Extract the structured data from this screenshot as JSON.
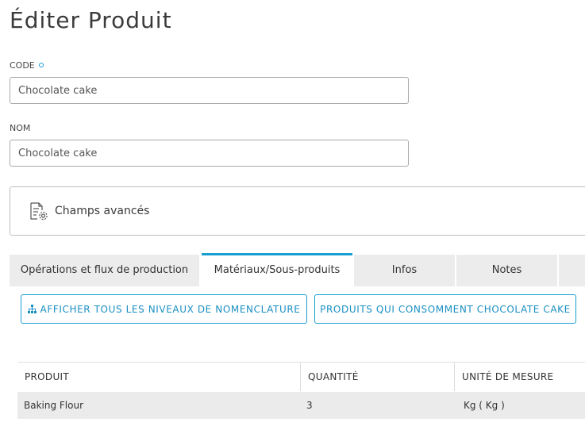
{
  "page": {
    "title": "Éditer Produit"
  },
  "form": {
    "code": {
      "label": "CODE",
      "value": "Chocolate cake"
    },
    "name": {
      "label": "NOM",
      "value": "Chocolate cake"
    }
  },
  "advanced": {
    "label": "Champs avancés",
    "icon": "document-settings-icon"
  },
  "tabs": [
    {
      "label": "Opérations et flux de production",
      "active": false
    },
    {
      "label": "Matériaux/Sous-produits",
      "active": true
    },
    {
      "label": "Infos",
      "active": false
    },
    {
      "label": "Notes",
      "active": false
    }
  ],
  "actions": {
    "show_levels": {
      "label": "AFFICHER TOUS LES NIVEAUX DE NOMENCLATURE",
      "icon": "hierarchy-icon"
    },
    "consuming_products": {
      "label": "PRODUITS QUI CONSOMMENT CHOCOLATE CAKE"
    }
  },
  "table": {
    "columns": [
      "PRODUIT",
      "QUANTITÉ",
      "UNITÉ DE MESURE"
    ],
    "rows": [
      [
        "Baking Flour",
        "3",
        "Kg ( Kg )"
      ]
    ]
  },
  "colors": {
    "accent": "#1a9fd3",
    "tab_inactive": "#ececec",
    "row_background": "#ebebeb",
    "border": "#a9a9a9"
  }
}
